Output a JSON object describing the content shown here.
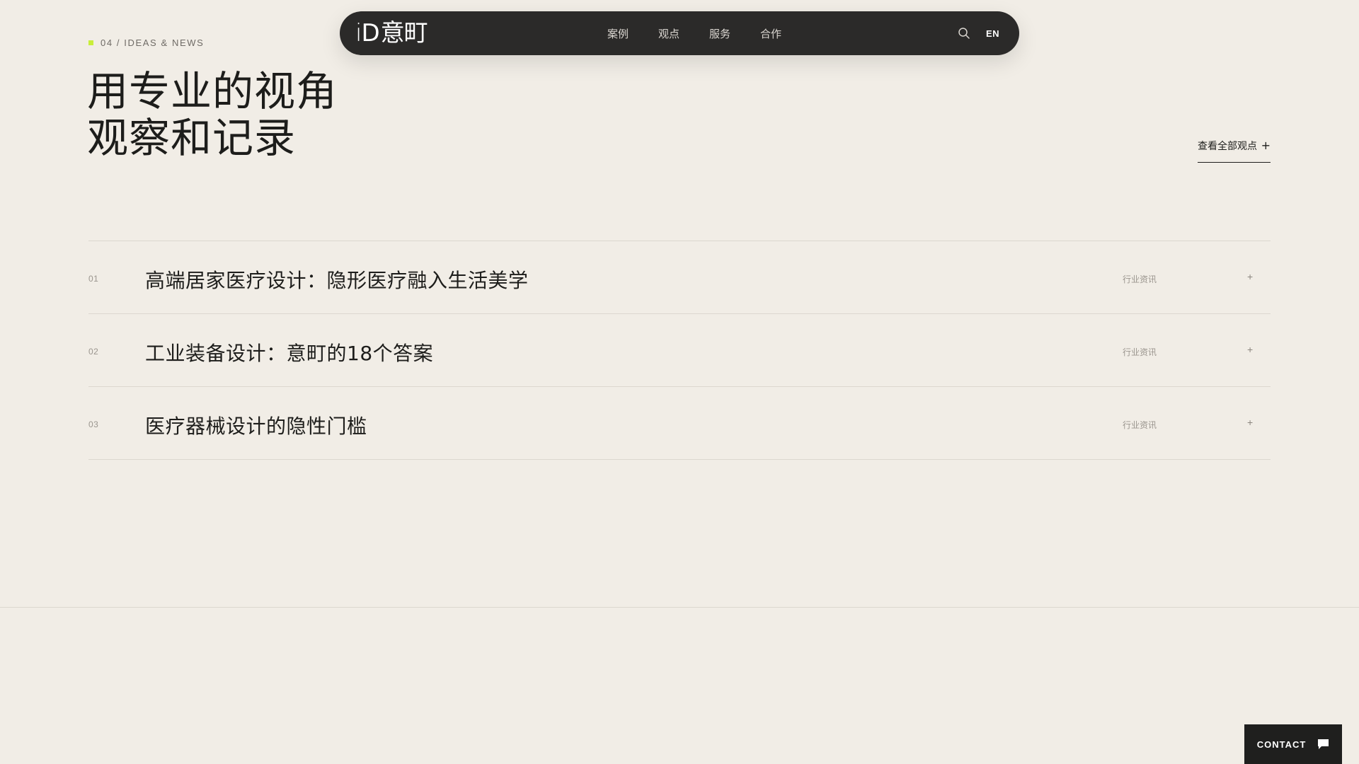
{
  "nav": {
    "logo_i": "i",
    "logo_d": "D",
    "logo_cn": "意町",
    "links": [
      {
        "label": "案例"
      },
      {
        "label": "观点"
      },
      {
        "label": "服务"
      },
      {
        "label": "合作"
      }
    ],
    "search_icon": "search-icon",
    "lang_label": "EN"
  },
  "section": {
    "tag": "04 / IDEAS & NEWS",
    "tag_color": "#c9ee3a",
    "headline_line1": "用专业的视角",
    "headline_line2": "观察和记录",
    "view_all_label": "查看全部观点",
    "view_all_icon": "+"
  },
  "articles": [
    {
      "num": "01",
      "title": "高端居家医疗设计：隐形医疗融入生活美学",
      "category": "行业资讯",
      "icon": "+"
    },
    {
      "num": "02",
      "title": "工业装备设计：意町的18个答案",
      "category": "行业资讯",
      "icon": "+"
    },
    {
      "num": "03",
      "title": "医疗器械设计的隐性门槛",
      "category": "行业资讯",
      "icon": "+"
    }
  ],
  "contact": {
    "label": "CONTACT",
    "icon": "chat-icon"
  },
  "colors": {
    "background": "#f1ede6",
    "nav_bg": "#2b2a29",
    "text": "#1d1d1b",
    "accent": "#c9ee3a",
    "contact_bg": "#1f1f1e"
  }
}
